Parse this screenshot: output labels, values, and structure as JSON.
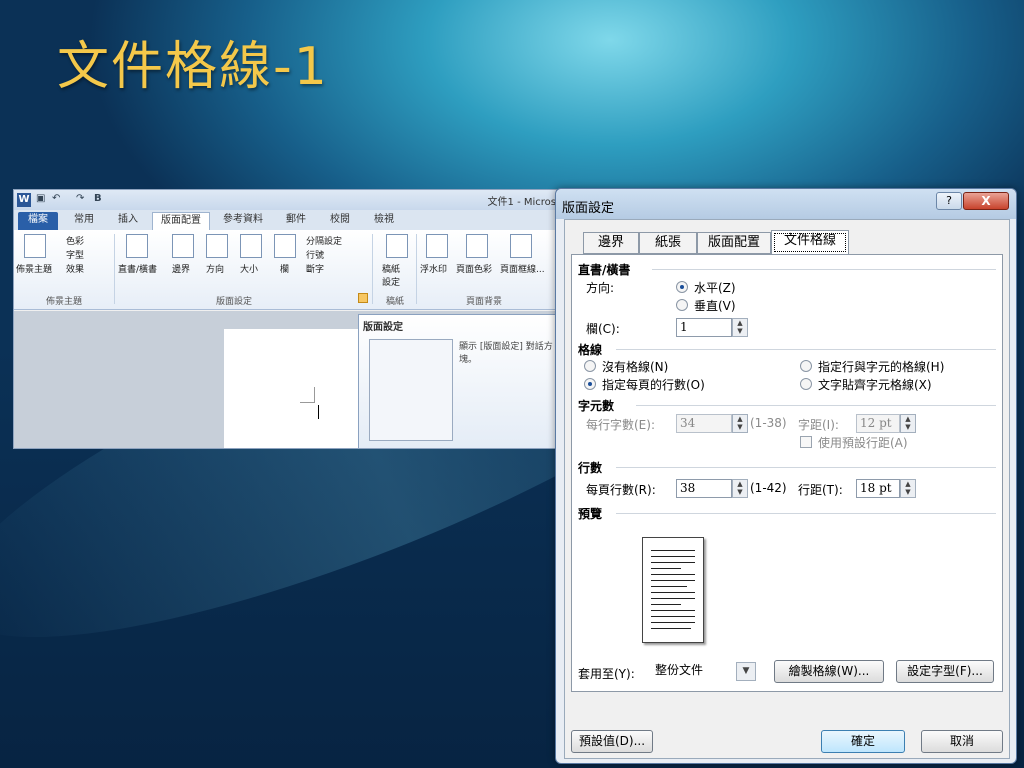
{
  "slide": {
    "title": "文件格線-1"
  },
  "ribbon": {
    "app_icon": "W",
    "bold_glyph": "B",
    "doc_title": "文件1 - Micros",
    "tabs": [
      "檔案",
      "常用",
      "插入",
      "版面配置",
      "參考資料",
      "郵件",
      "校閱",
      "檢視"
    ],
    "active_tab": "版面配置",
    "theme_group": {
      "label": "佈景主題",
      "buttons": [
        "佈景主題",
        "色彩",
        "字型",
        "效果"
      ]
    },
    "page_setup_group": {
      "label": "版面設定",
      "buttons": [
        "直書/橫書",
        "邊界",
        "方向",
        "大小",
        "欄"
      ],
      "small": [
        "分隔設定",
        "行號",
        "斷字"
      ]
    },
    "paper_group": {
      "label": "稿紙",
      "button": "稿紙\n設定"
    },
    "bg_group": {
      "label": "頁面背景",
      "buttons": [
        "浮水印",
        "頁面色彩",
        "頁面框線..."
      ]
    },
    "tooltip": {
      "title": "版面設定",
      "desc": "顯示 [版面設定] 對話方塊。"
    }
  },
  "dialog": {
    "title": "版面設定",
    "help": "?",
    "close": "X",
    "tabs": [
      "邊界",
      "紙張",
      "版面配置",
      "文件格線"
    ],
    "active_tab": "文件格線",
    "text_direction": {
      "section": "直書/橫書",
      "direction_label": "方向:",
      "horizontal": "水平(Z)",
      "vertical": "垂直(V)",
      "columns_label": "欄(C):",
      "columns_value": "1"
    },
    "grid": {
      "section": "格線",
      "no_grid": "沒有格線(N)",
      "lines_only": "指定每頁的行數(O)",
      "lines_and_chars": "指定行與字元的格線(H)",
      "snap_chars": "文字貼齊字元格線(X)",
      "selected": "指定每頁的行數(O)"
    },
    "characters": {
      "section": "字元數",
      "per_line_label": "每行字數(E):",
      "per_line_value": "34",
      "per_line_range": "(1-38)",
      "pitch_label": "字距(I):",
      "pitch_value": "12 pt",
      "use_default": "使用預設行距(A)"
    },
    "lines": {
      "section": "行數",
      "per_page_label": "每頁行數(R):",
      "per_page_value": "38",
      "per_page_range": "(1-42)",
      "pitch_label": "行距(T):",
      "pitch_value": "18 pt"
    },
    "preview": {
      "section": "預覽"
    },
    "apply_to_label": "套用至(Y):",
    "apply_to_value": "整份文件",
    "draw_grid_button": "繪製格線(W)...",
    "font_button": "設定字型(F)...",
    "default_button": "預設值(D)...",
    "ok_button": "確定",
    "cancel_button": "取消"
  }
}
